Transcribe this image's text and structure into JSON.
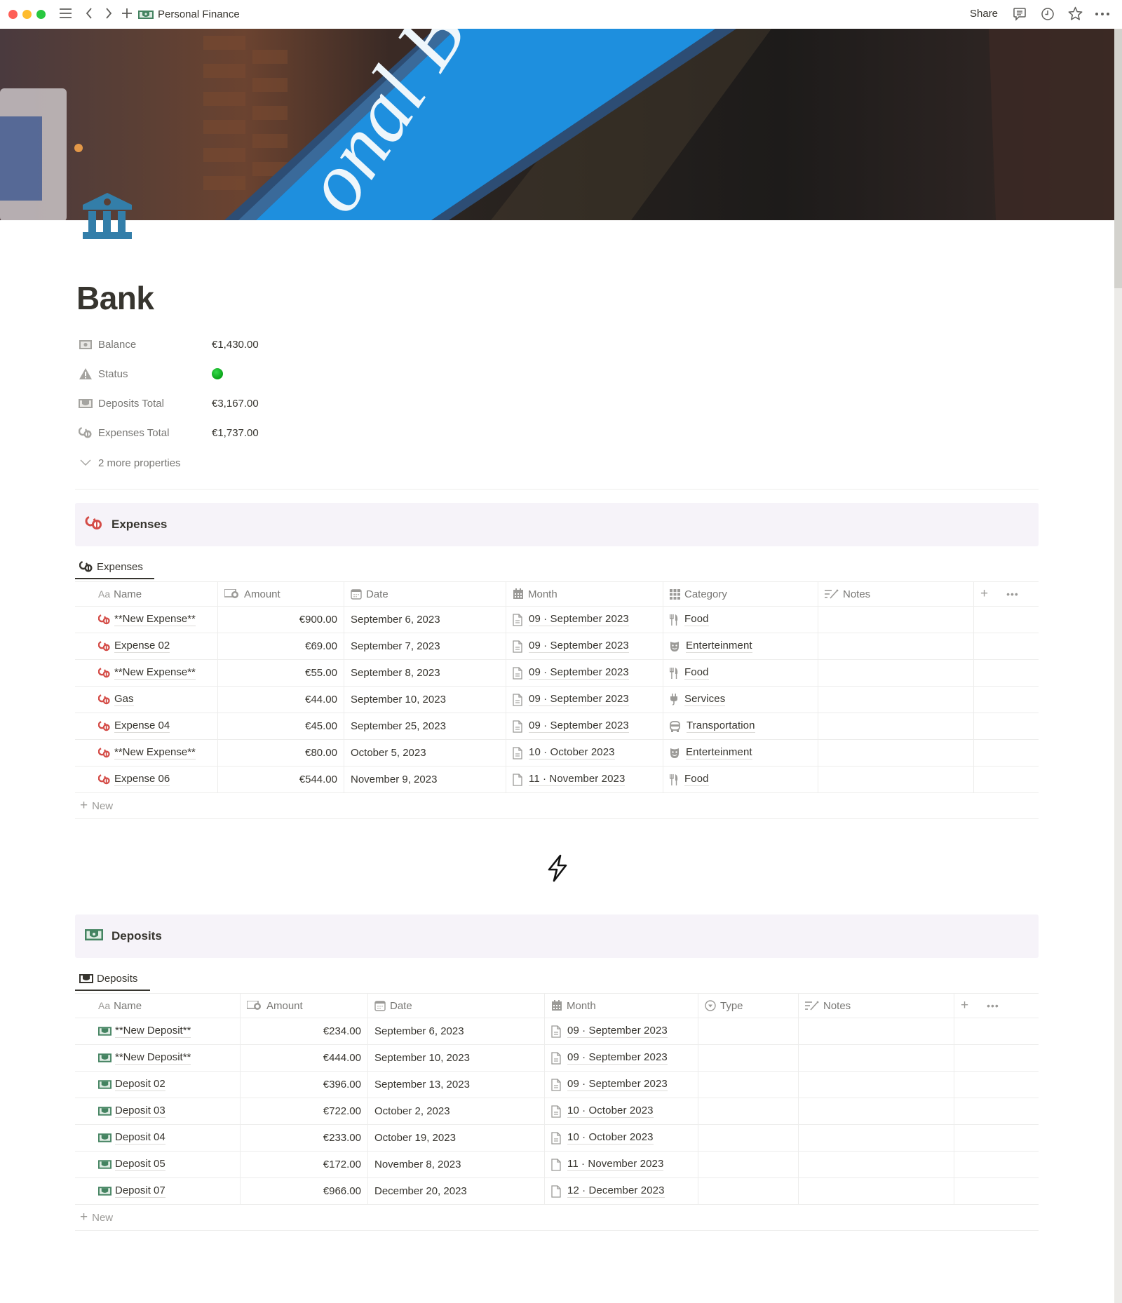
{
  "window": {
    "breadcrumb_title": "Personal Finance",
    "share_label": "Share",
    "icons": [
      "sidebar-menu-icon",
      "back-icon",
      "forward-icon",
      "new-page-icon",
      "comments-icon",
      "history-icon",
      "favorite-icon",
      "more-icon"
    ]
  },
  "page": {
    "title": "Bank",
    "icon": "bank-icon",
    "cover_text": "onal Bank"
  },
  "properties": [
    {
      "icon": "money-icon",
      "label": "Balance",
      "value": "€1,430.00"
    },
    {
      "icon": "warning-icon",
      "label": "Status",
      "value": "",
      "status_color": "#0fb022"
    },
    {
      "icon": "deposit-icon",
      "label": "Deposits Total",
      "value": "€3,167.00"
    },
    {
      "icon": "expense-icon",
      "label": "Expenses Total",
      "value": "€1,737.00"
    }
  ],
  "more_properties_label": "2 more properties",
  "expenses": {
    "callout_title": "Expenses",
    "view_tab": "Expenses",
    "columns": [
      "Name",
      "Amount",
      "Date",
      "Month",
      "Category",
      "Notes"
    ],
    "column_prefix_name": "Aa",
    "rows": [
      {
        "name": "**New Expense**",
        "amount": "€900.00",
        "date": "September 6, 2023",
        "month": "09 · September 2023",
        "category": "Food",
        "category_icon": "fork-knife-icon",
        "notes": ""
      },
      {
        "name": "Expense 02",
        "amount": "€69.00",
        "date": "September 7, 2023",
        "month": "09 · September 2023",
        "category": "Enterteinment",
        "category_icon": "theater-mask-icon",
        "notes": ""
      },
      {
        "name": "**New Expense**",
        "amount": "€55.00",
        "date": "September 8, 2023",
        "month": "09 · September 2023",
        "category": "Food",
        "category_icon": "fork-knife-icon",
        "notes": ""
      },
      {
        "name": "Gas",
        "amount": "€44.00",
        "date": "September 10, 2023",
        "month": "09 · September 2023",
        "category": "Services",
        "category_icon": "plug-icon",
        "notes": ""
      },
      {
        "name": "Expense 04",
        "amount": "€45.00",
        "date": "September 25, 2023",
        "month": "09 · September 2023",
        "category": "Transportation",
        "category_icon": "bus-icon",
        "notes": ""
      },
      {
        "name": "**New Expense**",
        "amount": "€80.00",
        "date": "October 5, 2023",
        "month": "10 · October 2023",
        "category": "Enterteinment",
        "category_icon": "theater-mask-icon",
        "notes": ""
      },
      {
        "name": "Expense 06",
        "amount": "€544.00",
        "date": "November 9, 2023",
        "month": "11 · November 2023",
        "category": "Food",
        "category_icon": "fork-knife-icon",
        "notes": ""
      }
    ],
    "new_label": "New"
  },
  "deposits": {
    "callout_title": "Deposits",
    "view_tab": "Deposits",
    "columns": [
      "Name",
      "Amount",
      "Date",
      "Month",
      "Type",
      "Notes"
    ],
    "column_prefix_name": "Aa",
    "rows": [
      {
        "name": "**New Deposit**",
        "amount": "€234.00",
        "date": "September 6, 2023",
        "month": "09 · September 2023",
        "type": "",
        "notes": ""
      },
      {
        "name": "**New Deposit**",
        "amount": "€444.00",
        "date": "September 10, 2023",
        "month": "09 · September 2023",
        "type": "",
        "notes": ""
      },
      {
        "name": "Deposit 02",
        "amount": "€396.00",
        "date": "September 13, 2023",
        "month": "09 · September 2023",
        "type": "",
        "notes": ""
      },
      {
        "name": "Deposit 03",
        "amount": "€722.00",
        "date": "October 2, 2023",
        "month": "10 · October 2023",
        "type": "",
        "notes": ""
      },
      {
        "name": "Deposit 04",
        "amount": "€233.00",
        "date": "October 19, 2023",
        "month": "10 · October 2023",
        "type": "",
        "notes": ""
      },
      {
        "name": "Deposit 05",
        "amount": "€172.00",
        "date": "November 8, 2023",
        "month": "11 · November 2023",
        "type": "",
        "notes": ""
      },
      {
        "name": "Deposit 07",
        "amount": "€966.00",
        "date": "December 20, 2023",
        "month": "12 · December 2023",
        "type": "",
        "notes": ""
      }
    ],
    "new_label": "New"
  },
  "colors": {
    "expense_red": "#d44c47",
    "deposit_green": "#448361",
    "bank_icon_blue": "#337ea9",
    "callout_bg": "#f6f3f9",
    "status_green": "#0fb022"
  }
}
